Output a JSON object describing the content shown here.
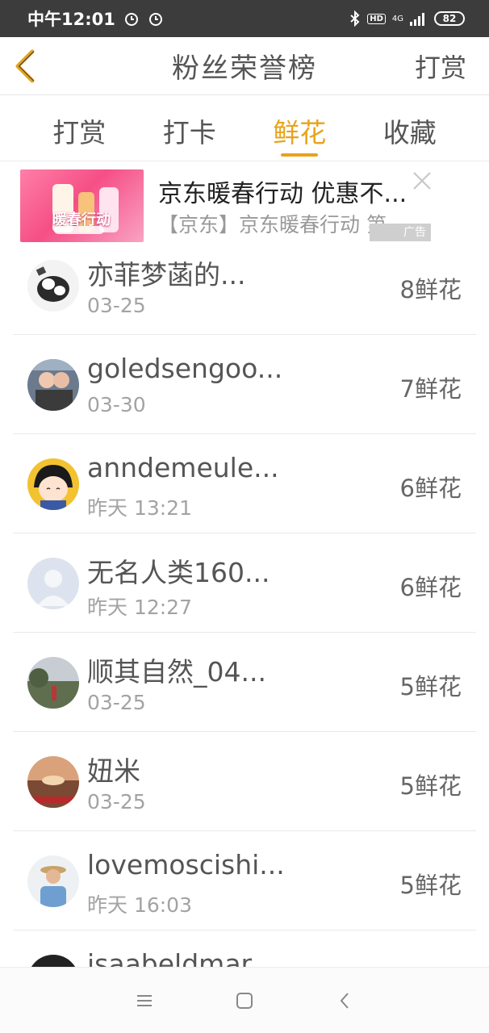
{
  "status_bar": {
    "time": "中午12:01",
    "network": "4G",
    "hd": "HD",
    "battery": "82"
  },
  "header": {
    "title": "粉丝荣誉榜",
    "action": "打赏"
  },
  "tabs": [
    {
      "label": "打赏",
      "active": false
    },
    {
      "label": "打卡",
      "active": false
    },
    {
      "label": "鲜花",
      "active": true
    },
    {
      "label": "收藏",
      "active": false
    }
  ],
  "ad": {
    "image_text": "暖春行动",
    "title": "京东暖春行动 优惠不...",
    "subtitle": "【京东】京东暖春行动 第",
    "label": "广告"
  },
  "fans": [
    {
      "name": "亦菲梦菡的...",
      "time": "03-25",
      "count": "8鲜花",
      "avatar_color": "#d9d9d9"
    },
    {
      "name": "goledsengoo...",
      "time": "03-30",
      "count": "7鲜花",
      "avatar_color": "#6b7a8c"
    },
    {
      "name": "anndemeule...",
      "time": "昨天 13:21",
      "count": "6鲜花",
      "avatar_color": "#f2c230"
    },
    {
      "name": "无名人类160...",
      "time": "昨天 12:27",
      "count": "6鲜花",
      "avatar_color": "#dde3ee"
    },
    {
      "name": "顺其自然_04...",
      "time": "03-25",
      "count": "5鲜花",
      "avatar_color": "#7a8a6a"
    },
    {
      "name": "妞米",
      "time": "03-25",
      "count": "5鲜花",
      "avatar_color": "#b8704a"
    },
    {
      "name": "lovemoscishi...",
      "time": "昨天 16:03",
      "count": "5鲜花",
      "avatar_color": "#9fb7cc"
    },
    {
      "name": "isaabeldmar...",
      "time": "",
      "count": "",
      "avatar_color": "#222222"
    }
  ],
  "colors": {
    "accent": "#e8a31b",
    "status_bar": "#3c3c3c"
  }
}
